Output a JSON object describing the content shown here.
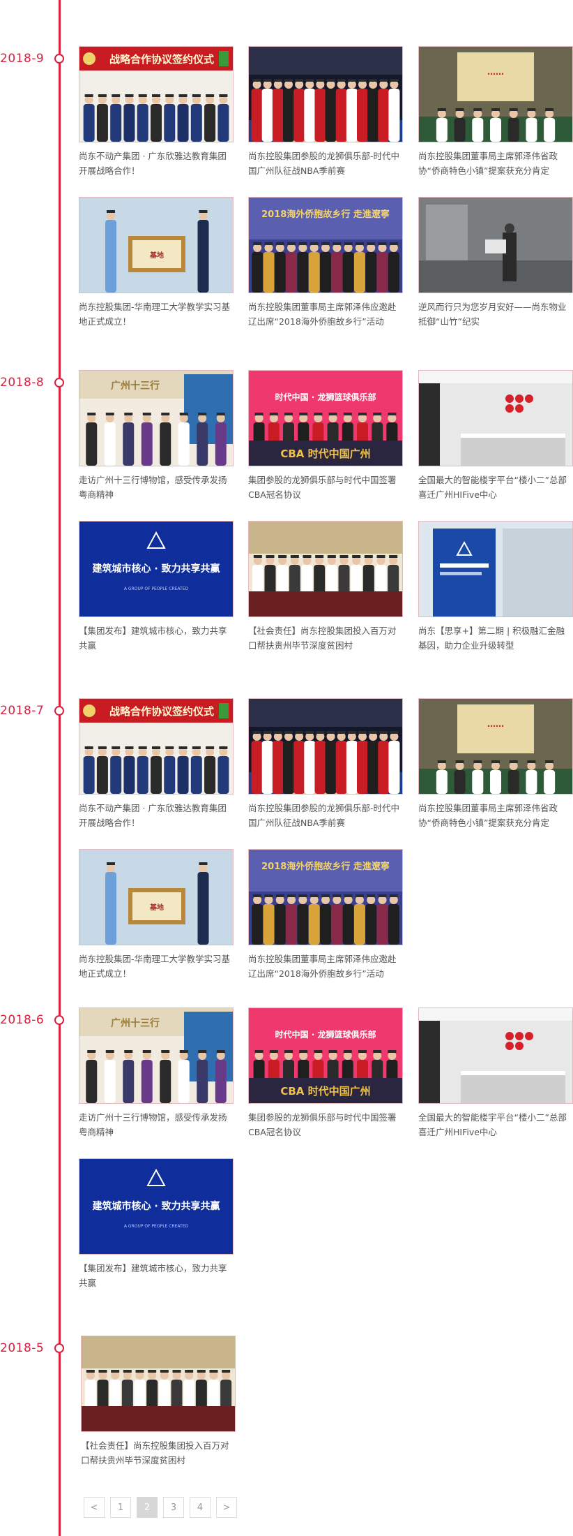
{
  "sections": [
    {
      "date": "2018-9",
      "items": [
        {
          "caption": "尚东不动产集团 · 广东欣雅达教育集团开展战略合作！",
          "thumb": "signing",
          "banner": "战略合作协议签约仪式"
        },
        {
          "caption": "尚东控股集团参股的龙狮俱乐部-时代中国广州队征战NBA季前赛",
          "thumb": "basketball"
        },
        {
          "caption": "尚东控股集团董事局主席郭泽伟省政协“侨商特色小镇”提案获充分肯定",
          "thumb": "conference"
        },
        {
          "caption": "尚东控股集团-华南理工大学教学实习基地正式成立！",
          "thumb": "plaque"
        },
        {
          "caption": "尚东控股集团董事局主席郭泽伟应邀赴辽出席“2018海外侨胞故乡行”活动",
          "thumb": "group",
          "banner": "2018海外侨胞故乡行 走進遼寧"
        },
        {
          "caption": "逆风而行只为您岁月安好——尚东物业抵御“山竹”纪实",
          "thumb": "flood"
        }
      ]
    },
    {
      "date": "2018-8",
      "items": [
        {
          "caption": "走访广州十三行博物馆，感受传承发扬粤商精神",
          "thumb": "museum",
          "banner": "广州十三行"
        },
        {
          "caption": "集团参股的龙狮俱乐部与时代中国签署CBA冠名协议",
          "thumb": "cba",
          "banner": "时代中国 · 龙狮篮球俱乐部",
          "sub": "CBA 时代中国广州"
        },
        {
          "caption": "全国最大的智能楼宇平台“楼小二”总部喜迁广州HIFive中心",
          "thumb": "office"
        },
        {
          "caption": "【集团发布】建筑城市核心，致力共享共赢",
          "thumb": "blue",
          "banner": "建筑城市核心 · 致力共享共赢",
          "sub": "A GROUP OF PEOPLE CREATED"
        },
        {
          "caption": "【社会责任】尚东控股集团投入百万对口帮扶贵州毕节深度贫困村",
          "thumb": "charity"
        },
        {
          "caption": "尚东【思享+】第二期 | 积极融汇金融基因，助力企业升级转型",
          "thumb": "banner"
        }
      ]
    },
    {
      "date": "2018-7",
      "items": [
        {
          "caption": "尚东不动产集团 · 广东欣雅达教育集团开展战略合作！",
          "thumb": "signing",
          "banner": "战略合作协议签约仪式"
        },
        {
          "caption": "尚东控股集团参股的龙狮俱乐部-时代中国广州队征战NBA季前赛",
          "thumb": "basketball"
        },
        {
          "caption": "尚东控股集团董事局主席郭泽伟省政协“侨商特色小镇”提案获充分肯定",
          "thumb": "conference"
        },
        {
          "caption": "尚东控股集团-华南理工大学教学实习基地正式成立！",
          "thumb": "plaque"
        },
        {
          "caption": "尚东控股集团董事局主席郭泽伟应邀赴辽出席“2018海外侨胞故乡行”活动",
          "thumb": "group",
          "banner": "2018海外侨胞故乡行 走進遼寧"
        }
      ]
    },
    {
      "date": "2018-6",
      "items": [
        {
          "caption": "走访广州十三行博物馆，感受传承发扬粤商精神",
          "thumb": "museum",
          "banner": "广州十三行"
        },
        {
          "caption": "集团参股的龙狮俱乐部与时代中国签署CBA冠名协议",
          "thumb": "cba",
          "banner": "时代中国 · 龙狮篮球俱乐部",
          "sub": "CBA 时代中国广州"
        },
        {
          "caption": "全国最大的智能楼宇平台“楼小二”总部喜迁广州HIFive中心",
          "thumb": "office"
        },
        {
          "caption": "【集团发布】建筑城市核心，致力共享共赢",
          "thumb": "blue",
          "banner": "建筑城市核心 · 致力共享共赢",
          "sub": "A GROUP OF PEOPLE CREATED"
        }
      ]
    },
    {
      "date": "2018-5",
      "items": [
        {
          "caption": "【社会责任】尚东控股集团投入百万对口帮扶贵州毕节深度贫困村",
          "thumb": "charity"
        }
      ]
    }
  ],
  "pagination": {
    "prev": "<",
    "pages": [
      "1",
      "2",
      "3",
      "4"
    ],
    "current": "2",
    "next": ">"
  },
  "colors": {
    "accent": "#d8203f",
    "line": "#dc1f3c"
  }
}
